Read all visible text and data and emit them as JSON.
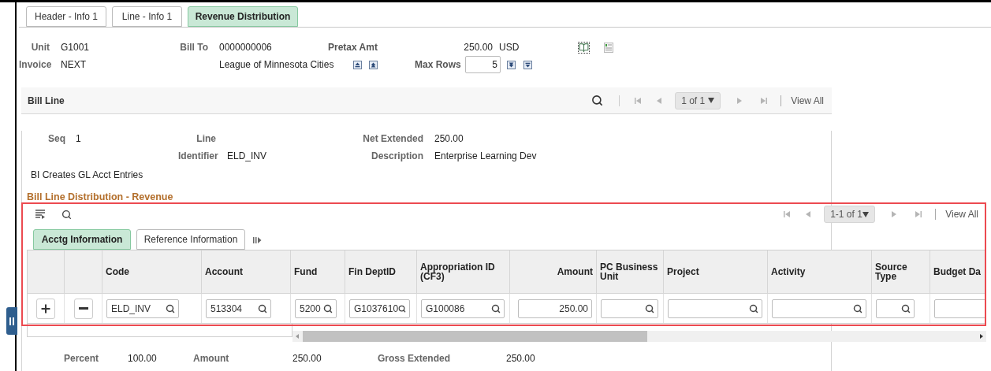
{
  "page_tabs": [
    {
      "label": "Header - Info 1",
      "selected": false
    },
    {
      "label": "Line - Info 1",
      "selected": false
    },
    {
      "label": "Revenue Distribution",
      "selected": true
    }
  ],
  "header": {
    "unit": {
      "label": "Unit",
      "value": "G1001"
    },
    "invoice": {
      "label": "Invoice",
      "value": "NEXT"
    },
    "bill_to": {
      "label": "Bill To",
      "value": "0000000006",
      "name": "League of Minnesota Cities"
    },
    "pretax_amt": {
      "label": "Pretax Amt",
      "value": "250.00",
      "currency": "USD"
    },
    "max_rows": {
      "label": "Max Rows",
      "value": "5"
    }
  },
  "bill_line": {
    "title": "Bill Line",
    "pager": "1 of 1",
    "view_all": "View All",
    "seq": {
      "label": "Seq",
      "value": "1"
    },
    "line": {
      "label": "Line"
    },
    "identifier": {
      "label": "Identifier",
      "value": "ELD_INV"
    },
    "net_extended": {
      "label": "Net Extended",
      "value": "250.00"
    },
    "description": {
      "label": "Description",
      "value": "Enterprise Learning Dev"
    },
    "note": "BI Creates GL Acct Entries"
  },
  "distribution": {
    "title": "Bill Line Distribution - Revenue",
    "pager": "1-1 of 1",
    "view_all": "View All",
    "tabs": [
      {
        "label": "Acctg Information",
        "selected": true
      },
      {
        "label": "Reference Information",
        "selected": false
      }
    ],
    "columns": [
      {
        "label": "Code",
        "kind": "lookup",
        "value": "ELD_INV"
      },
      {
        "label": "Account",
        "kind": "lookup",
        "value": "513304"
      },
      {
        "label": "Fund",
        "kind": "lookup",
        "value": "5200"
      },
      {
        "label": "Fin DeptID",
        "kind": "lookup",
        "value": "G1037610"
      },
      {
        "label": "Appropriation ID (CF3)",
        "kind": "lookup",
        "value": "G100086"
      },
      {
        "label": "Amount",
        "kind": "amount",
        "value": "250.00"
      },
      {
        "label": "PC Business Unit",
        "kind": "lookup"
      },
      {
        "label": "Project",
        "kind": "lookup"
      },
      {
        "label": "Activity",
        "kind": "lookup"
      },
      {
        "label": "Source Type",
        "kind": "lookup"
      },
      {
        "label": "Budget Da",
        "kind": "text"
      }
    ],
    "totals": [
      {
        "label": "Percent",
        "value": "100.00"
      },
      {
        "label": "Amount",
        "value": "250.00"
      },
      {
        "label": "Gross Extended",
        "value": "250.00"
      }
    ]
  }
}
